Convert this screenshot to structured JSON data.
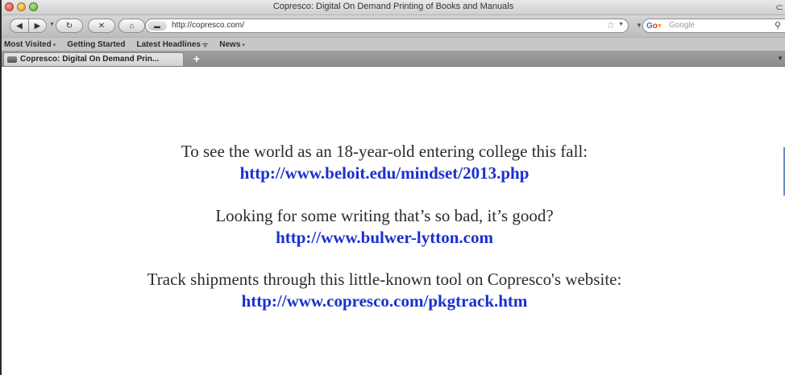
{
  "window": {
    "title": "Copresco: Digital On Demand Printing of Books and Manuals"
  },
  "toolbar": {
    "url": "http://copresco.com/",
    "search_placeholder": "Google"
  },
  "bookmarks": [
    {
      "label": "Most Visited",
      "has_menu": true
    },
    {
      "label": "Getting Started",
      "has_menu": false
    },
    {
      "label": "Latest Headlines",
      "has_menu": false,
      "rss": true
    },
    {
      "label": "News",
      "has_menu": true
    }
  ],
  "tabs": [
    {
      "label": "Copresco: Digital On Demand Prin...",
      "active": true
    }
  ],
  "newtab_label": "+",
  "content": {
    "items": [
      {
        "text": "To see the world as an 18-year-old entering college this fall:",
        "link": "http://www.beloit.edu/mindset/2013.php"
      },
      {
        "text": "Looking for some writing that’s so bad, it’s good?",
        "link": "http://www.bulwer-lytton.com"
      },
      {
        "text": "Track shipments through this little-known tool on Copresco's website:",
        "link": "http://www.copresco.com/pkgtrack.htm"
      }
    ]
  },
  "colors": {
    "link": "#1a2fd0",
    "body_text": "#2b2b2b"
  },
  "icons": [
    "back-icon",
    "forward-icon",
    "reload-icon",
    "stop-icon",
    "home-icon",
    "bookmark-star-icon",
    "search-icon",
    "rss-icon"
  ]
}
